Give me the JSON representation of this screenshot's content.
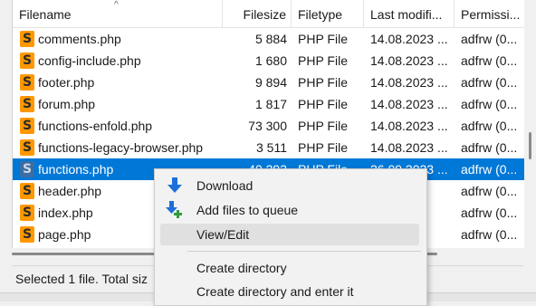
{
  "columns": {
    "filename": "Filename",
    "filesize": "Filesize",
    "filetype": "Filetype",
    "last_modified": "Last modifi...",
    "permissions": "Permissi..."
  },
  "sort_indicator": "^",
  "files": [
    {
      "name": "comments.php",
      "size": "5 884",
      "type": "PHP File",
      "modified": "14.08.2023 ...",
      "perm": "adfrw (0..."
    },
    {
      "name": "config-include.php",
      "size": "1 680",
      "type": "PHP File",
      "modified": "14.08.2023 ...",
      "perm": "adfrw (0..."
    },
    {
      "name": "footer.php",
      "size": "9 894",
      "type": "PHP File",
      "modified": "14.08.2023 ...",
      "perm": "adfrw (0..."
    },
    {
      "name": "forum.php",
      "size": "1 817",
      "type": "PHP File",
      "modified": "14.08.2023 ...",
      "perm": "adfrw (0..."
    },
    {
      "name": "functions-enfold.php",
      "size": "73 300",
      "type": "PHP File",
      "modified": "14.08.2023 ...",
      "perm": "adfrw (0..."
    },
    {
      "name": "functions-legacy-browser.php",
      "size": "3 511",
      "type": "PHP File",
      "modified": "14.08.2023 ...",
      "perm": "adfrw (0..."
    },
    {
      "name": "functions.php",
      "size": "40 293",
      "type": "PHP File",
      "modified": "26.09.2023 ...",
      "perm": "adfrw (0...",
      "selected": true
    },
    {
      "name": "header.php",
      "size": "",
      "type": "",
      "modified": "",
      "perm": "adfrw (0..."
    },
    {
      "name": "index.php",
      "size": "",
      "type": "",
      "modified": "",
      "perm": "adfrw (0..."
    },
    {
      "name": "page.php",
      "size": "",
      "type": "",
      "modified": "",
      "perm": "adfrw (0..."
    }
  ],
  "file_icon_glyph": "S",
  "status": {
    "text": "Selected 1 file. Total siz"
  },
  "context_menu": {
    "items": [
      {
        "label": "Download",
        "icon": "download-icon"
      },
      {
        "label": "Add files to queue",
        "icon": "add-to-queue-icon"
      },
      {
        "label": "View/Edit",
        "icon": "",
        "hovered": true
      },
      {
        "label": "Create directory",
        "icon": ""
      },
      {
        "label": "Create directory and enter it",
        "icon": ""
      }
    ]
  },
  "colors": {
    "selection": "#0078d7",
    "file_icon": "#ff9800",
    "download_arrow": "#1e6fd9",
    "queue_plus": "#2e9c3a"
  }
}
